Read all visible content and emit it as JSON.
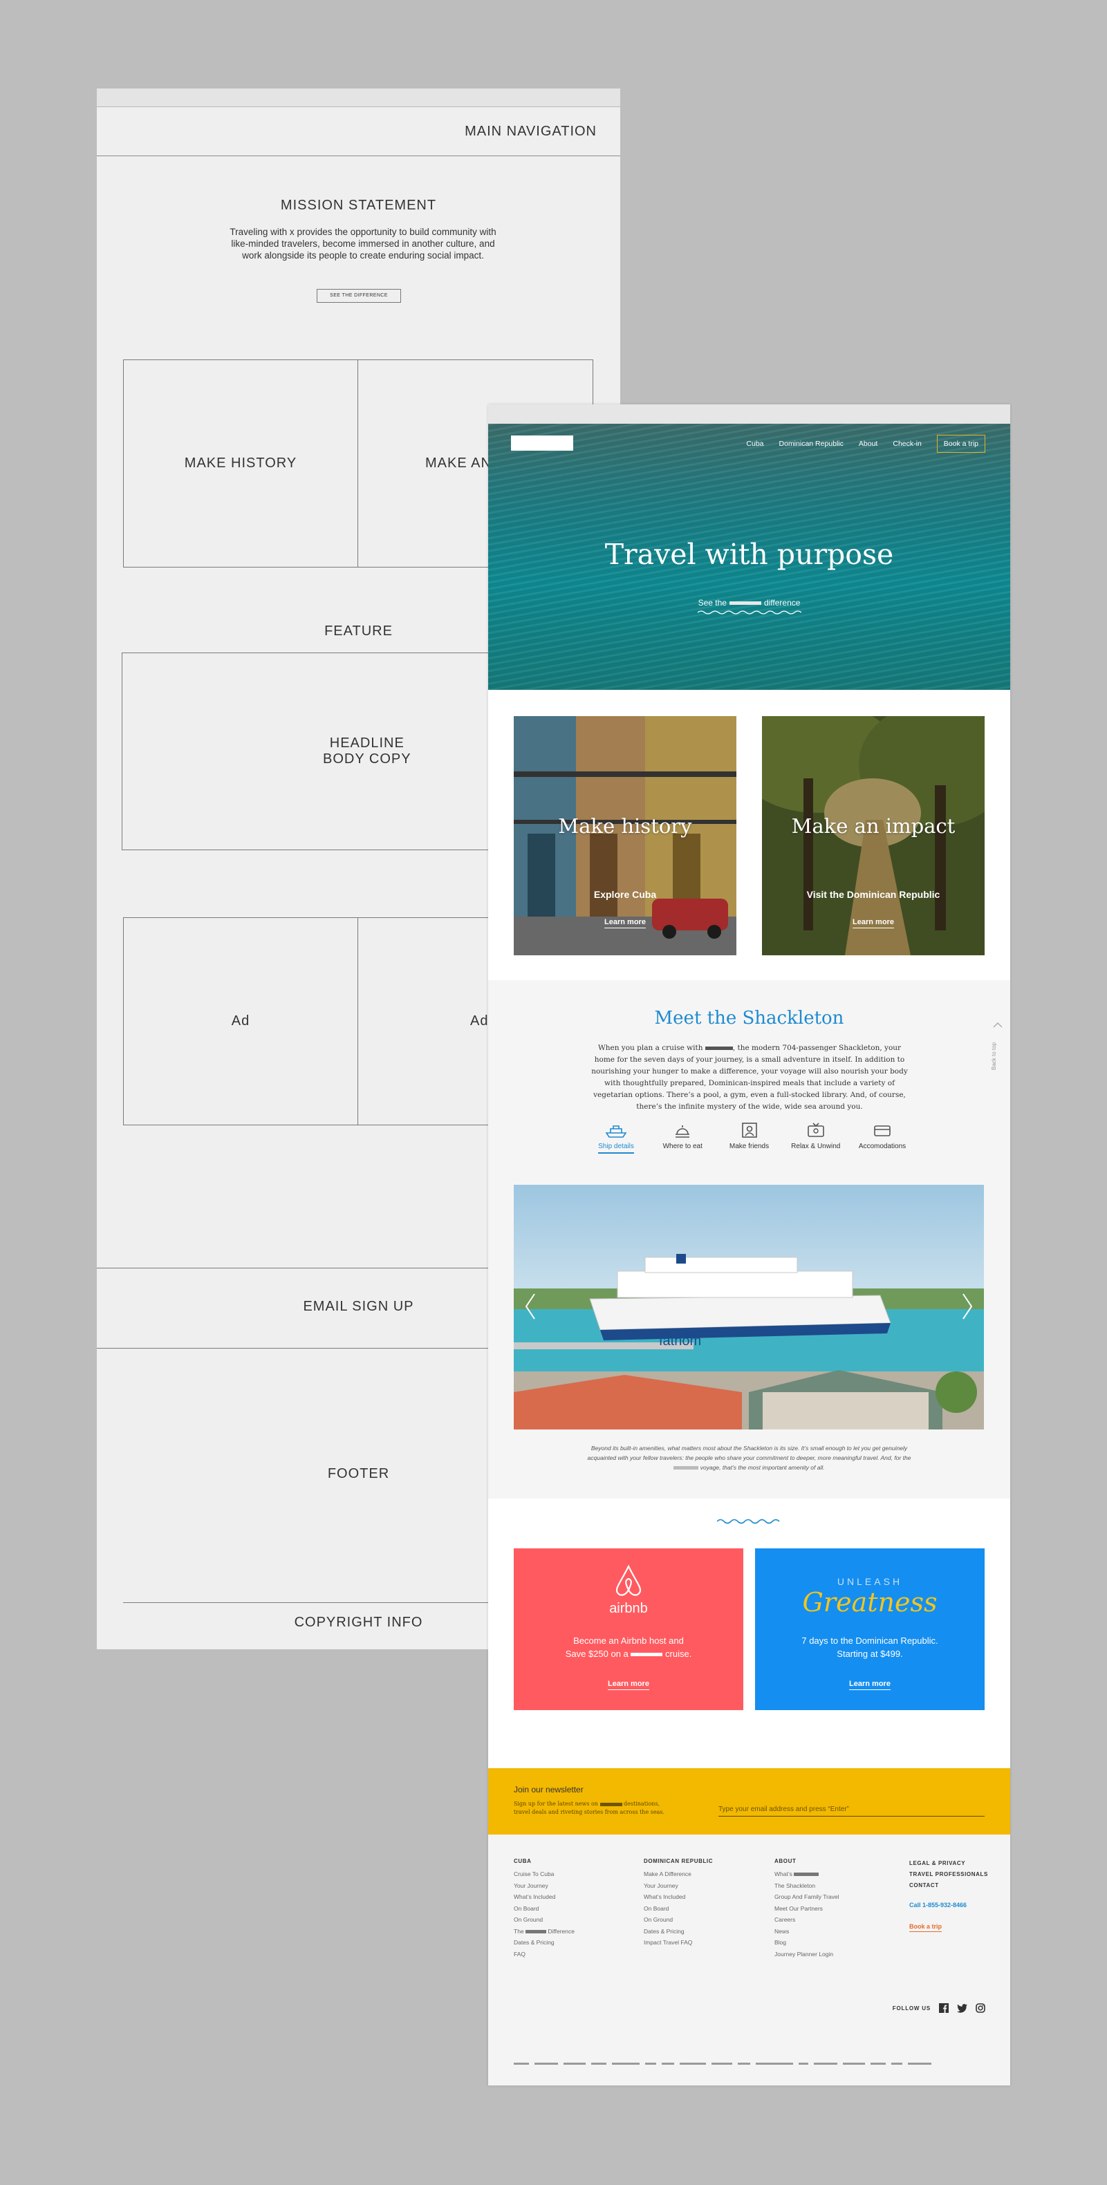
{
  "wireframe": {
    "nav_label": "MAIN NAVIGATION",
    "mission_title": "MISSION STATEMENT",
    "mission_body": "Traveling with x provides the opportunity to build community with like-minded travelers, become immersed in another culture, and work alongside its people to create enduring social impact.",
    "mission_button": "SEE THE DIFFERENCE",
    "box_1": "MAKE HISTORY",
    "box_2": "MAKE AN",
    "feature_label": "FEATURE",
    "feature_box": "HEADLINE\nBODY COPY",
    "ad_1": "Ad",
    "ad_2": "Ad",
    "email": "EMAIL SIGN UP",
    "footer": "FOOTER",
    "copyright": "COPYRIGHT INFO"
  },
  "nav": {
    "items": [
      "Cuba",
      "Dominican Republic",
      "About",
      "Check-in"
    ],
    "book": "Book a trip"
  },
  "hero": {
    "title": "Travel with purpose",
    "cta_before": "See the",
    "cta_after": "difference"
  },
  "cards": [
    {
      "title": "Make history",
      "sub": "Explore Cuba",
      "link": "Learn more"
    },
    {
      "title": "Make an impact",
      "sub": "Visit the Dominican Republic",
      "link": "Learn more"
    }
  ],
  "ship": {
    "title": "Meet the Shackleton",
    "body_a": "When you plan a cruise with",
    "body_b": ", the modern 704-passenger Shackleton, your home for the seven days of your journey, is a small adventure in itself. In addition to nourishing your hunger to make a difference, your voyage will also nourish your body with thoughtfully prepared, Dominican-inspired meals that include a variety of vegetarian options. There’s a pool, a gym, even a full-stocked library. And, of course, there’s the infinite mystery of the wide, wide sea around you.",
    "tabs": [
      "Ship details",
      "Where to eat",
      "Make friends",
      "Relax & Unwind",
      "Accomodations"
    ],
    "back_to_top": "Back to top",
    "hull_text": "fathom",
    "caption_a": "Beyond its built-in amenities, what matters most about the Shackleton is its size. It’s small enough to let you get genuinely acquainted with your fellow travelers: the people who share your commitment to deeper, more meaningful travel. And, for the",
    "caption_b": "voyage, that’s the most important amenity of all."
  },
  "promos": {
    "airbnb_logo": "airbnb",
    "airbnb_text_a": "Become an Airbnb host and",
    "airbnb_text_b": "Save $250 on a",
    "airbnb_text_c": "cruise.",
    "airbnb_link": "Learn more",
    "unleash": "UNLEASH",
    "greatness": "Greatness",
    "dr_text_a": "7 days to the Dominican Republic.",
    "dr_text_b": "Starting at $499.",
    "dr_link": "Learn more",
    "colors": {
      "airbnb": "#ff5a5f",
      "dr": "#148ef0"
    }
  },
  "newsletter": {
    "title": "Join our newsletter",
    "sub_a": "Sign up for the latest news on",
    "sub_b": "destinations,",
    "sub_c": "travel deals and riveting stories from across the seas.",
    "placeholder": "Type your email address and press “Enter”"
  },
  "footer": {
    "cuba": {
      "title": "CUBA",
      "links": [
        "Cruise To Cuba",
        "Your Journey",
        "What’s Included",
        "On Board",
        "On Ground",
        "Dates & Pricing",
        "FAQ"
      ],
      "diff_before": "The",
      "diff_after": "Difference"
    },
    "dr": {
      "title": "DOMINICAN REPUBLIC",
      "links": [
        "Make A Difference",
        "Your Journey",
        "What’s Included",
        "On Board",
        "On Ground",
        "Dates & Pricing",
        "Impact Travel FAQ"
      ]
    },
    "about": {
      "title": "ABOUT",
      "whats": "What’s",
      "links": [
        "The Shackleton",
        "Group And Family Travel",
        "Meet Our Partners",
        "Careers",
        "News",
        "Blog",
        "Journey Planner Login"
      ]
    },
    "legal": [
      "LEGAL & PRIVACY",
      "TRAVEL PROFESSIONALS",
      "CONTACT"
    ],
    "phone": "Call 1-855-932-8466",
    "book": "Book a trip",
    "follow": "FOLLOW US"
  }
}
